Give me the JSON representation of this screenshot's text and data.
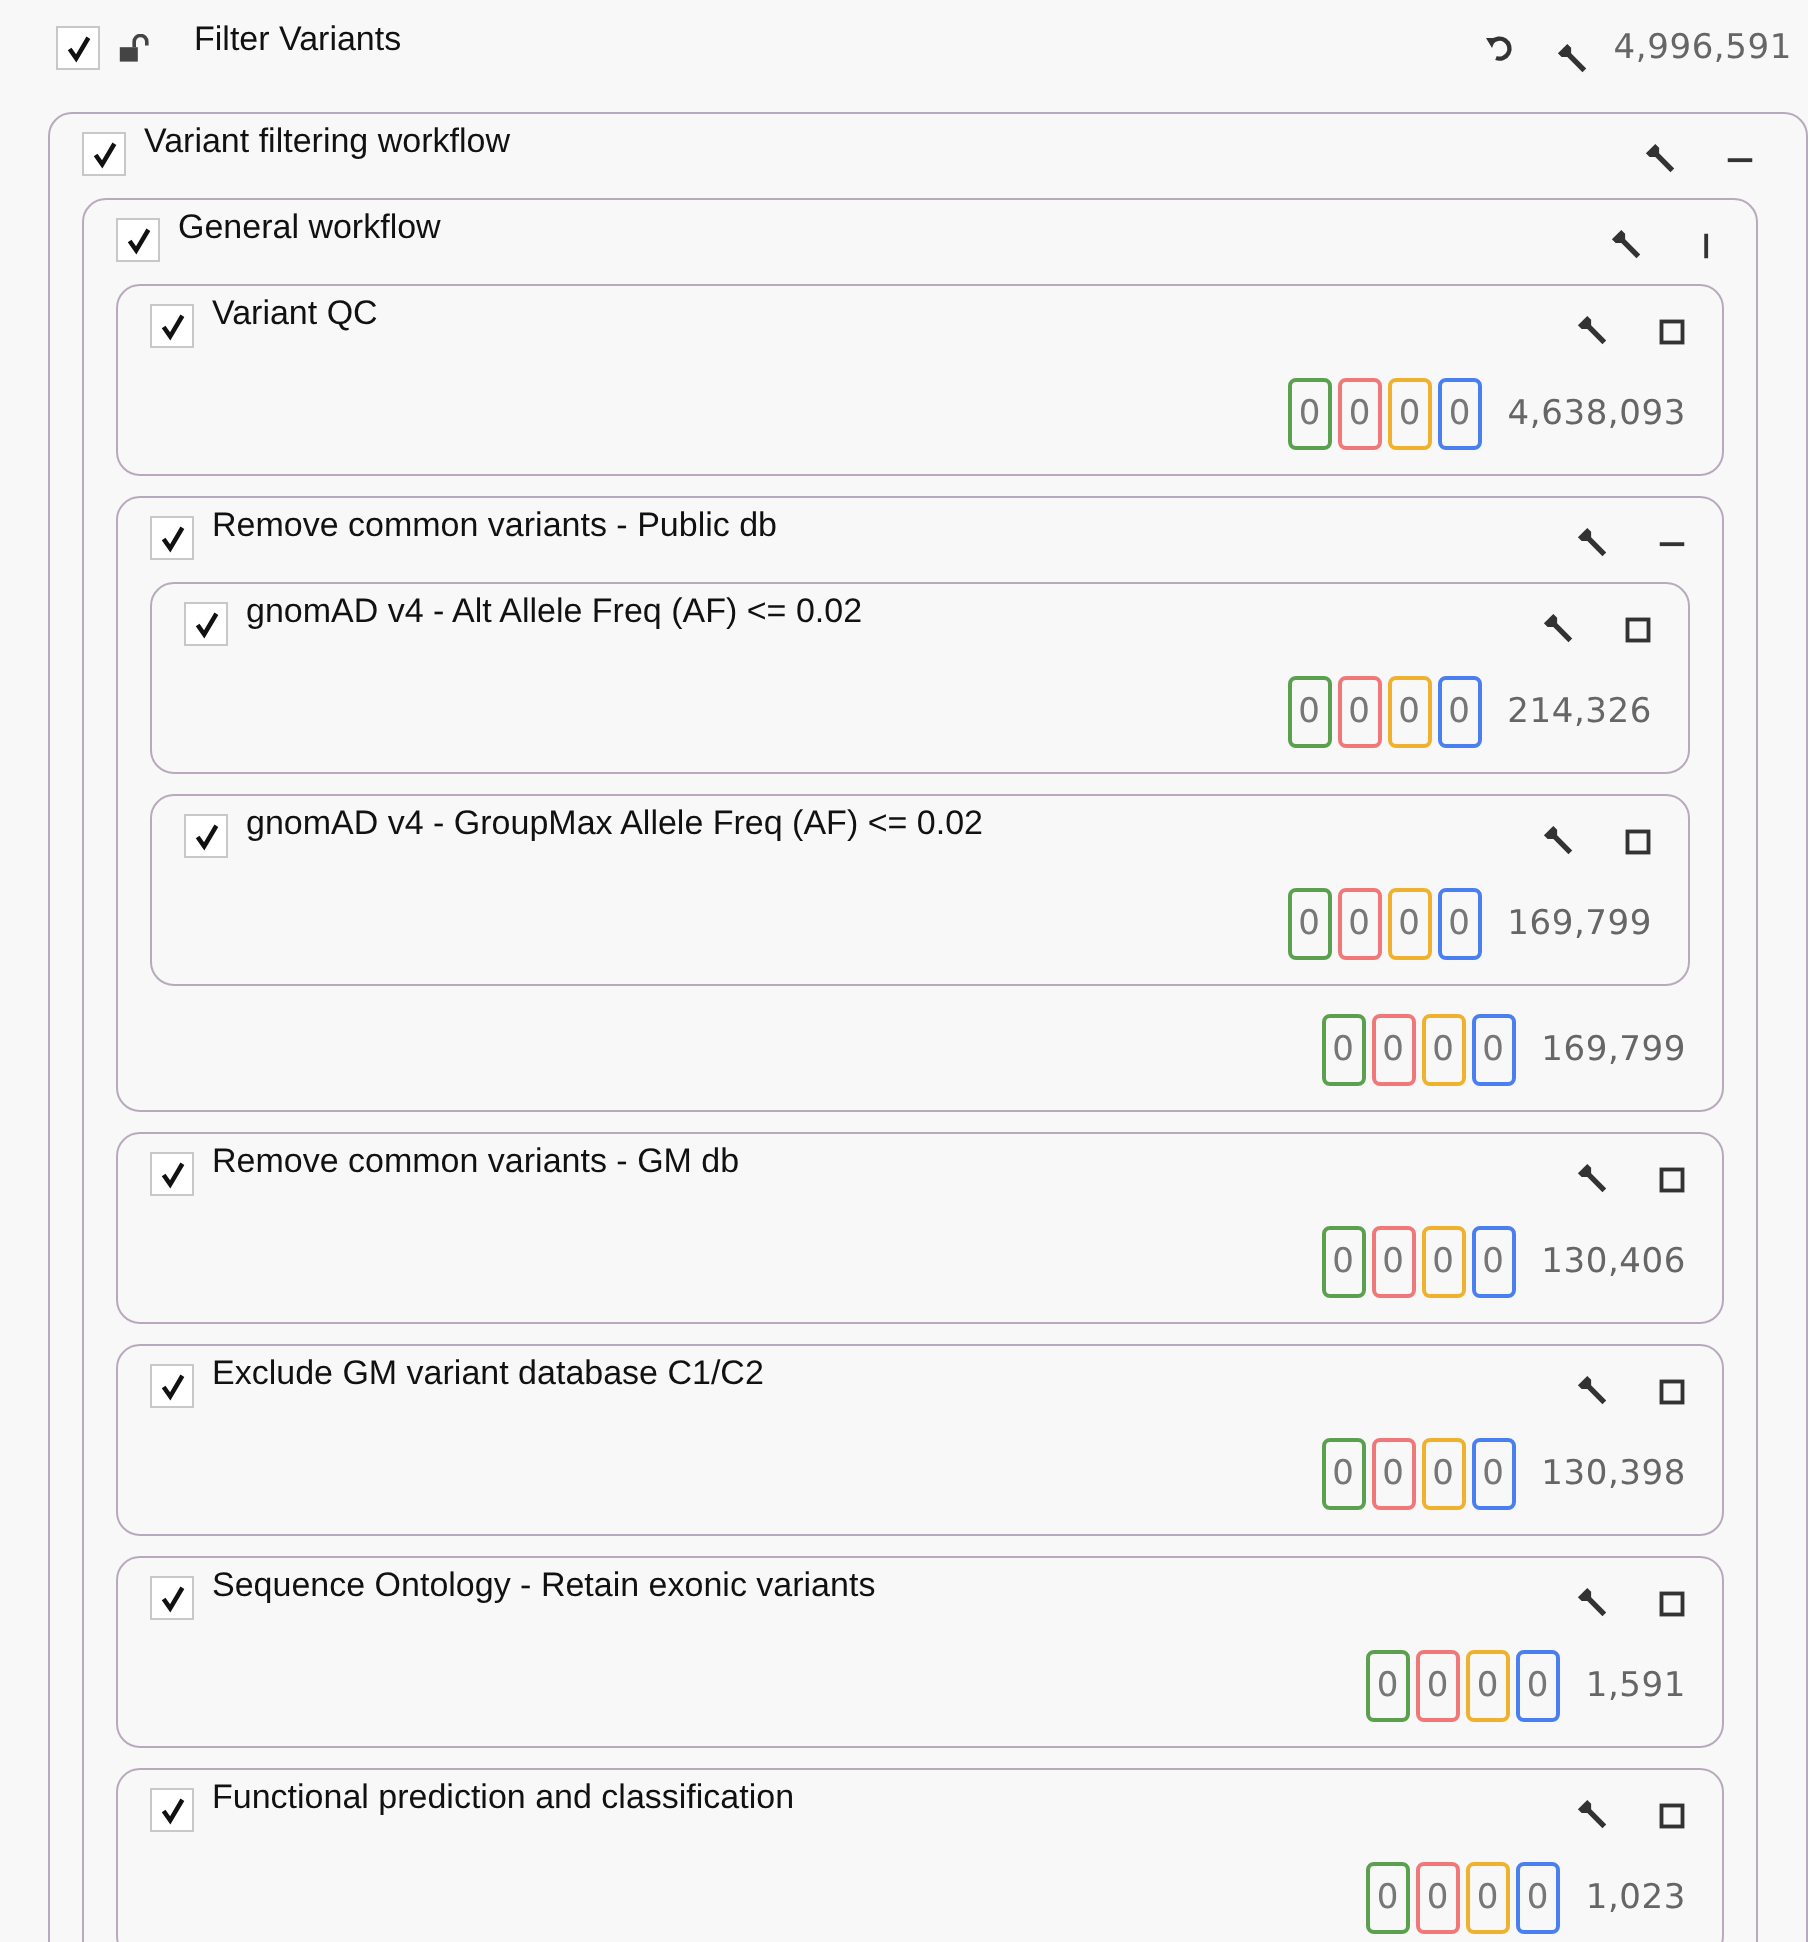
{
  "filter": {
    "label": "Filter Variants",
    "checked": true,
    "locked": false,
    "count": "4,996,591"
  },
  "workflow": {
    "label": "Variant filtering workflow",
    "checked": true,
    "kind": "minus",
    "children": [
      {
        "label": "General workflow",
        "checked": true,
        "kind": "bar",
        "children": [
          {
            "label": "Variant QC",
            "checked": true,
            "kind": "square",
            "badges": [
              {
                "text": "0",
                "color": "#5aa04e"
              },
              {
                "text": "0",
                "color": "#f07878"
              },
              {
                "text": "0",
                "color": "#f0b22e"
              },
              {
                "text": "0",
                "color": "#4a7ff0"
              }
            ],
            "count": "4,638,093"
          },
          {
            "label": "Remove common variants - Public db",
            "checked": true,
            "kind": "minus",
            "children": [
              {
                "label": "gnomAD v4 - Alt Allele Freq (AF) <= 0.02",
                "checked": true,
                "kind": "square",
                "badges": [
                  {
                    "text": "0",
                    "color": "#5aa04e"
                  },
                  {
                    "text": "0",
                    "color": "#f07878"
                  },
                  {
                    "text": "0",
                    "color": "#f0b22e"
                  },
                  {
                    "text": "0",
                    "color": "#4a7ff0"
                  }
                ],
                "count": "214,326"
              },
              {
                "label": "gnomAD v4 - GroupMax Allele Freq (AF) <= 0.02",
                "checked": true,
                "kind": "square",
                "badges": [
                  {
                    "text": "0",
                    "color": "#5aa04e"
                  },
                  {
                    "text": "0",
                    "color": "#f07878"
                  },
                  {
                    "text": "0",
                    "color": "#f0b22e"
                  },
                  {
                    "text": "0",
                    "color": "#4a7ff0"
                  }
                ],
                "count": "169,799"
              }
            ],
            "badges": [
              {
                "text": "0",
                "color": "#5aa04e"
              },
              {
                "text": "0",
                "color": "#f07878"
              },
              {
                "text": "0",
                "color": "#f0b22e"
              },
              {
                "text": "0",
                "color": "#4a7ff0"
              }
            ],
            "count": "169,799"
          },
          {
            "label": "Remove common variants - GM db",
            "checked": true,
            "kind": "square",
            "badges": [
              {
                "text": "0",
                "color": "#5aa04e"
              },
              {
                "text": "0",
                "color": "#f07878"
              },
              {
                "text": "0",
                "color": "#f0b22e"
              },
              {
                "text": "0",
                "color": "#4a7ff0"
              }
            ],
            "count": "130,406"
          },
          {
            "label": "Exclude GM variant database C1/C2",
            "checked": true,
            "kind": "square",
            "badges": [
              {
                "text": "0",
                "color": "#5aa04e"
              },
              {
                "text": "0",
                "color": "#f07878"
              },
              {
                "text": "0",
                "color": "#f0b22e"
              },
              {
                "text": "0",
                "color": "#4a7ff0"
              }
            ],
            "count": "130,398"
          },
          {
            "label": "Sequence Ontology - Retain exonic variants",
            "checked": true,
            "kind": "square",
            "badges": [
              {
                "text": "0",
                "color": "#5aa04e"
              },
              {
                "text": "0",
                "color": "#f07878"
              },
              {
                "text": "0",
                "color": "#f0b22e"
              },
              {
                "text": "0",
                "color": "#4a7ff0"
              }
            ],
            "count": "1,591"
          },
          {
            "label": "Functional prediction and classification",
            "checked": true,
            "kind": "square",
            "badges": [
              {
                "text": "0",
                "color": "#5aa04e"
              },
              {
                "text": "0",
                "color": "#f07878"
              },
              {
                "text": "0",
                "color": "#f0b22e"
              },
              {
                "text": "0",
                "color": "#4a7ff0"
              }
            ],
            "count": "1,023"
          }
        ]
      }
    ]
  }
}
